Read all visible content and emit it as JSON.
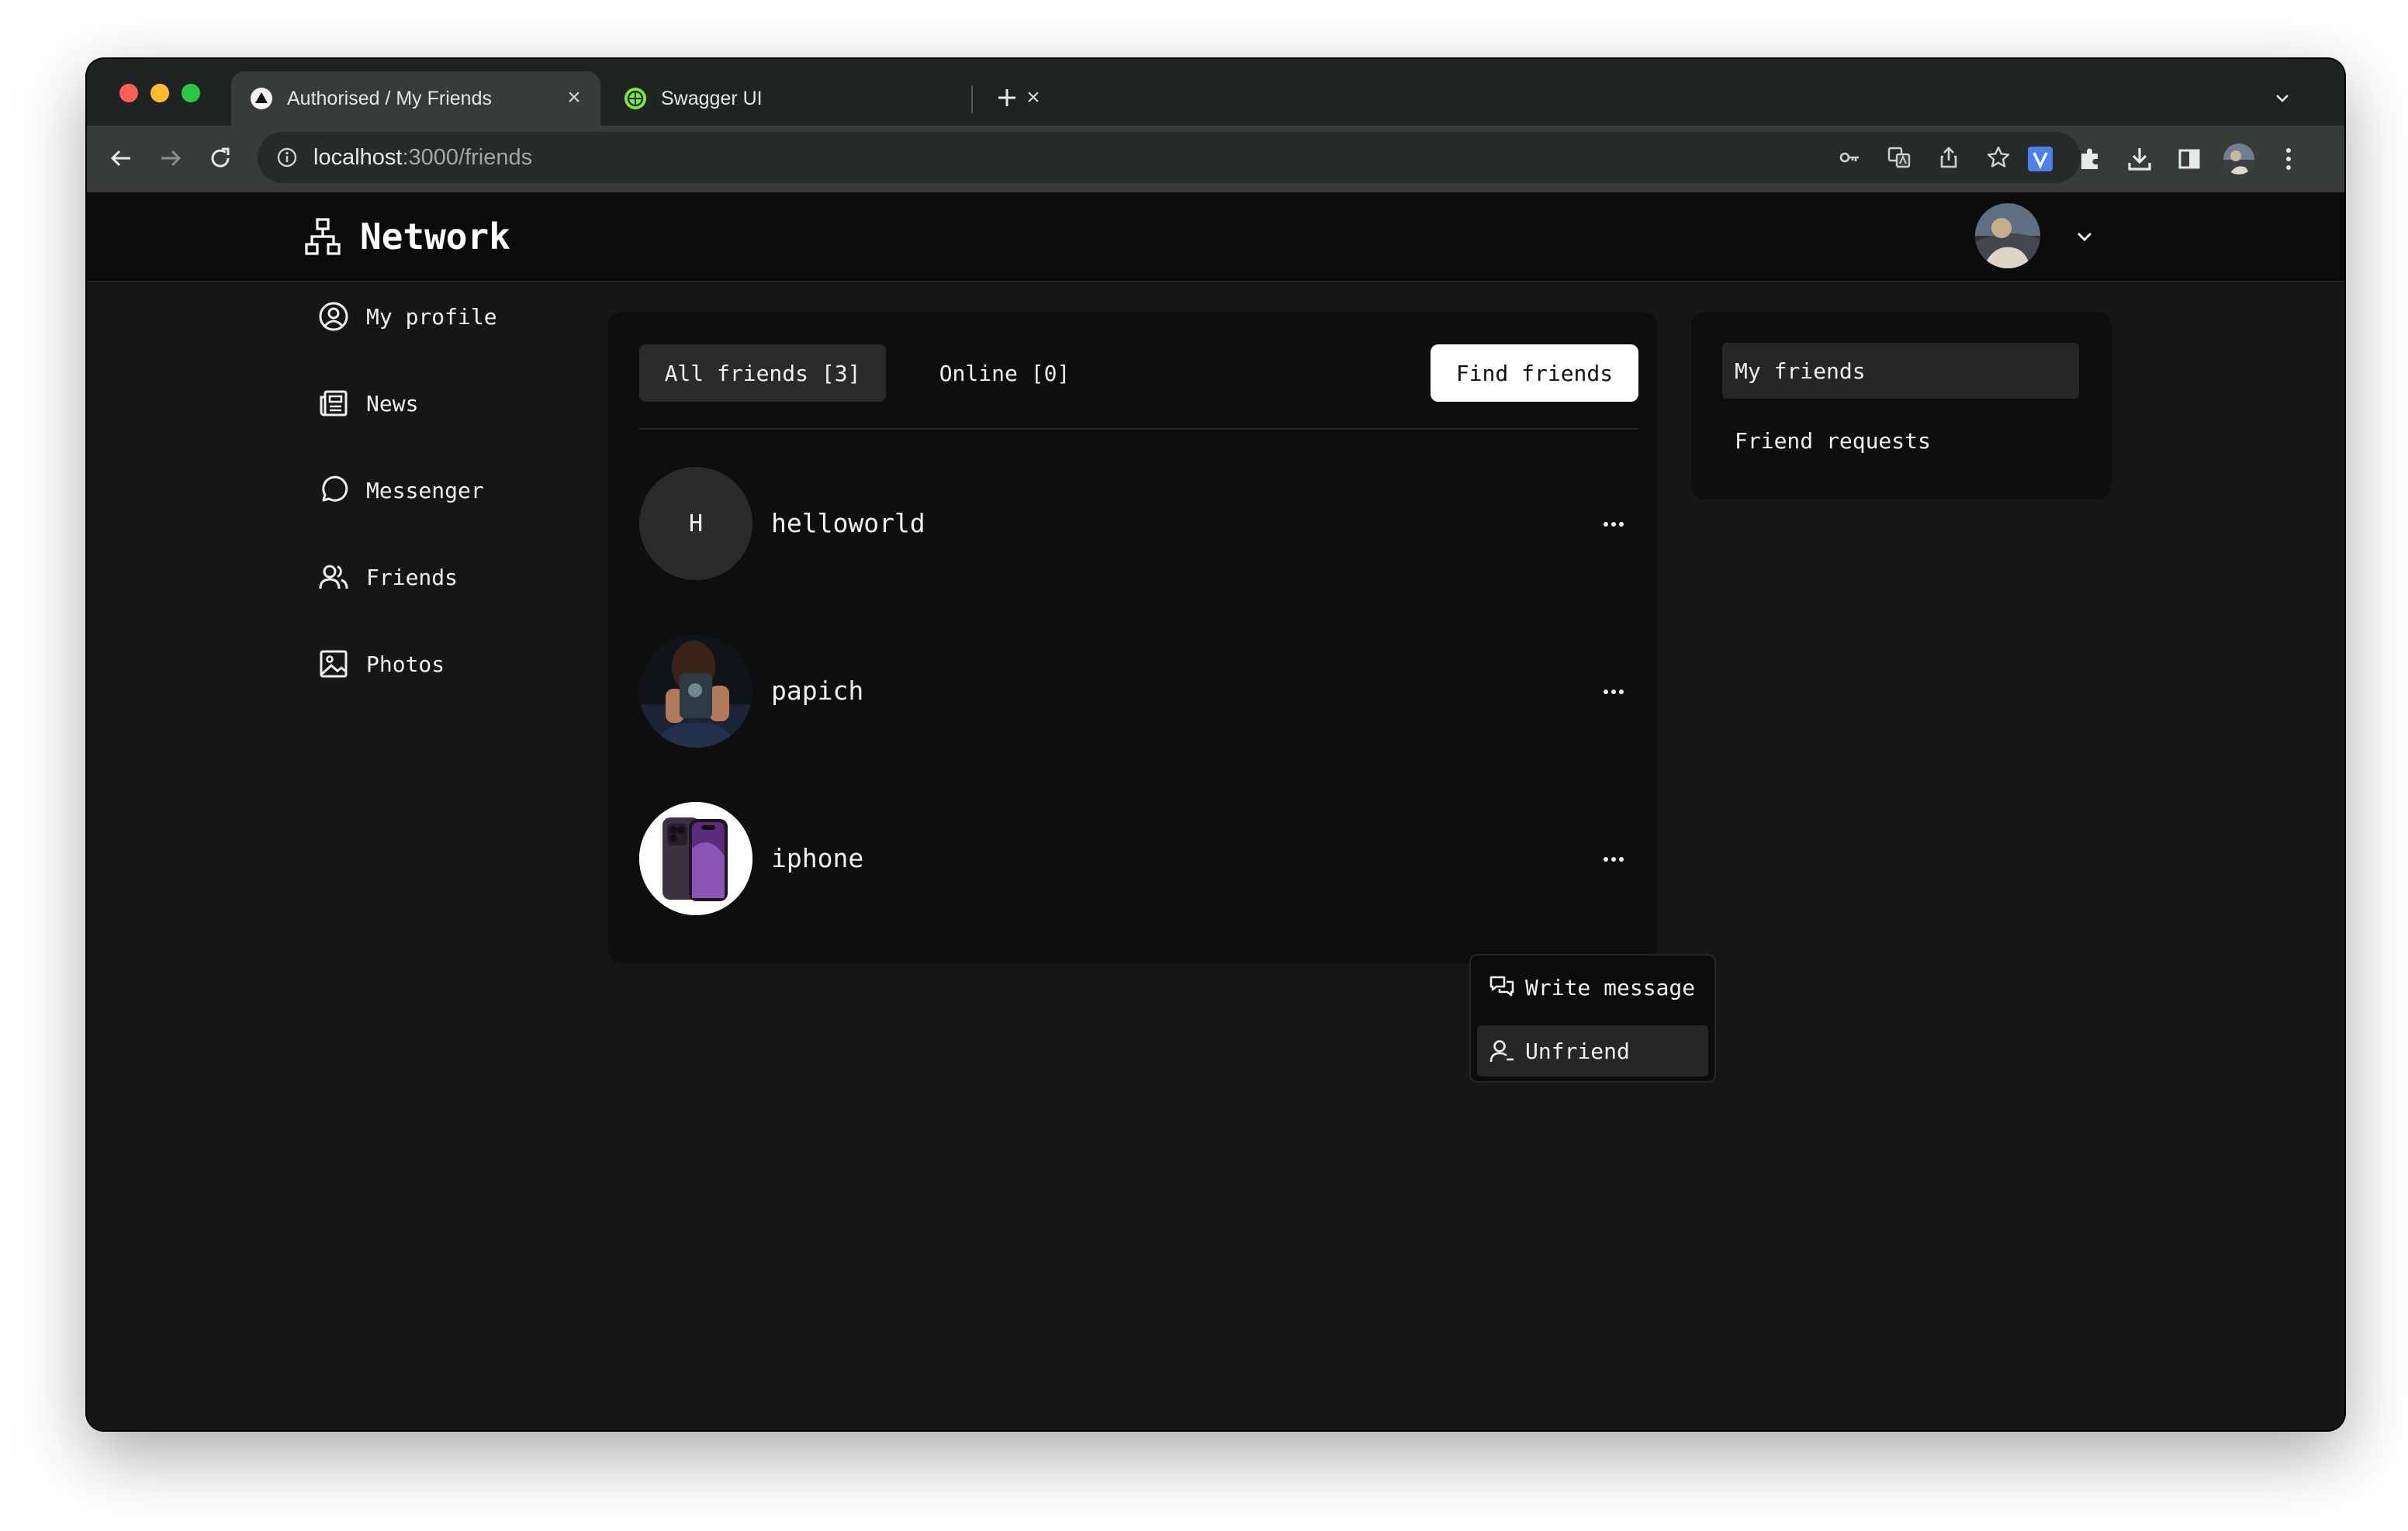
{
  "browser": {
    "tabs": [
      {
        "title": "Authorised / My Friends",
        "icon": "triangle-logo-icon",
        "active": true
      },
      {
        "title": "Swagger UI",
        "icon": "swagger-globe-icon",
        "active": false
      }
    ],
    "url_host": "localhost",
    "url_path": ":3000/friends",
    "colors": {
      "close": "#ff5f57",
      "minimize": "#febc2e",
      "maximize": "#28c840"
    }
  },
  "app": {
    "brand": "Network",
    "nav": [
      {
        "label": "My profile",
        "icon": "user-circle-icon"
      },
      {
        "label": "News",
        "icon": "newspaper-icon"
      },
      {
        "label": "Messenger",
        "icon": "chat-bubble-icon"
      },
      {
        "label": "Friends",
        "icon": "users-icon"
      },
      {
        "label": "Photos",
        "icon": "image-icon"
      }
    ],
    "filters": {
      "all": "All friends [3]",
      "online": "Online [0]",
      "find": "Find friends"
    },
    "friends": [
      {
        "name": "helloworld",
        "initial": "H"
      },
      {
        "name": "papich",
        "avatar": "photo"
      },
      {
        "name": "iphone",
        "avatar": "phone-image"
      }
    ],
    "context_menu": {
      "write": "Write message",
      "unfriend": "Unfriend"
    },
    "side_menu": {
      "my_friends": "My friends",
      "requests": "Friend requests"
    },
    "colors": {
      "accent_button": "#ffffff",
      "panel": "#0e0e0e",
      "background": "#161616"
    }
  }
}
